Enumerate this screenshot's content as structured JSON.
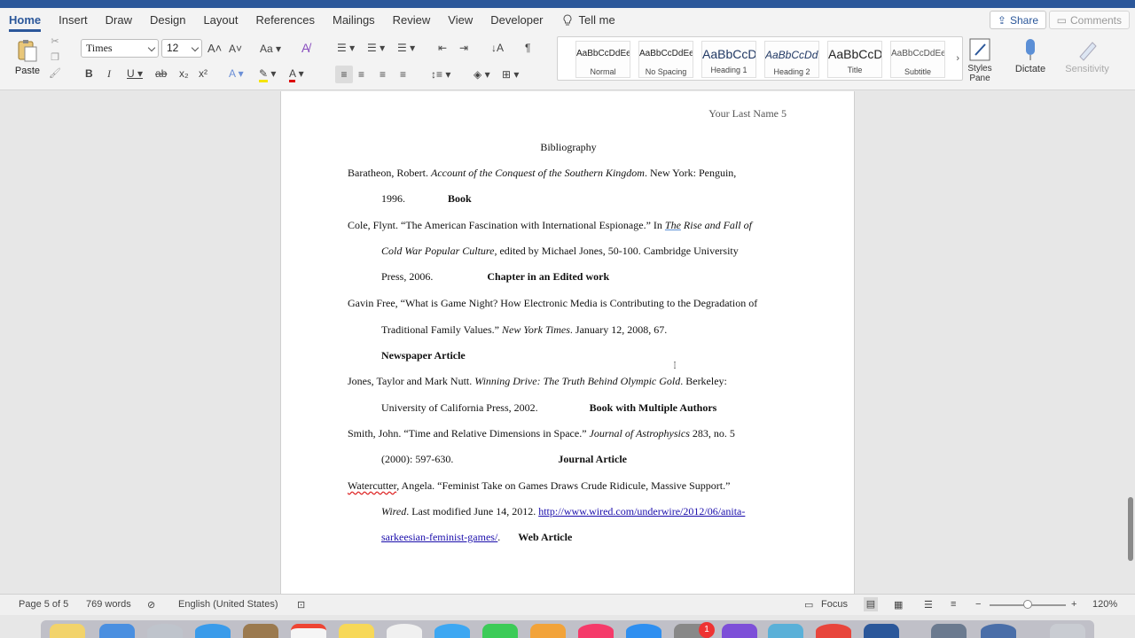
{
  "ribbon_tabs": [
    "Home",
    "Insert",
    "Draw",
    "Design",
    "Layout",
    "References",
    "Mailings",
    "Review",
    "View",
    "Developer"
  ],
  "tell_me": "Tell me",
  "share": "Share",
  "comments": "Comments",
  "clipboard": {
    "paste": "Paste"
  },
  "font": {
    "name": "Times",
    "size": "12"
  },
  "styles": [
    {
      "sample": "AaBbCcDdEe",
      "label": "Normal"
    },
    {
      "sample": "AaBbCcDdEe",
      "label": "No Spacing"
    },
    {
      "sample": "AaBbCcDc",
      "label": "Heading 1"
    },
    {
      "sample": "AaBbCcDdE",
      "label": "Heading 2"
    },
    {
      "sample": "AaBbCcDc",
      "label": "Title"
    },
    {
      "sample": "AaBbCcDdEe",
      "label": "Subtitle"
    }
  ],
  "styles_pane": "Styles\nPane",
  "dictate": "Dictate",
  "sensitivity": "Sensitivity",
  "document": {
    "header": "Your Last Name 5",
    "title": "Bibliography",
    "e1_author": "Baratheon, Robert. ",
    "e1_title": "Account of the Conquest of the Southern Kingdom",
    "e1_rest": ". New York: Penguin,",
    "e1_year": "1996.",
    "e1_type": "Book",
    "e2_a": "Cole, Flynt. “The American Fascination with International Espionage.” In ",
    "e2_the": "The",
    "e2_b": " Rise and Fall of",
    "e2_c": "Cold War Popular Culture",
    "e2_d": ", edited by Michael Jones, 50-100. Cambridge University",
    "e2_e": "Press, 2006.",
    "e2_type": "Chapter in an Edited work",
    "e3_a": "Gavin Free, “What is Game Night? How Electronic Media is Contributing to the Degradation of",
    "e3_b": "Traditional Family Values.” ",
    "e3_c": "New York Times",
    "e3_d": ". January 12, 2008, 67.",
    "e3_type": "Newspaper Article",
    "e4_a": "Jones, Taylor and Mark Nutt. ",
    "e4_b": "Winning Drive: The Truth Behind Olympic Gold",
    "e4_c": ". Berkeley:",
    "e4_d": "University of California Press, 2002.",
    "e4_type": "Book with Multiple Authors",
    "e5_a": "Smith, John. “Time and Relative Dimensions in Space.” ",
    "e5_b": "Journal of Astrophysics",
    "e5_c": " 283, no. 5",
    "e5_d": "(2000): 597-630.",
    "e5_type": "Journal Article",
    "e6_a": "Watercutter",
    "e6_b": ", Angela. “Feminist Take on Games Draws Crude Ridicule, Massive Support.”",
    "e6_c": "Wired",
    "e6_d": ". Last modified June 14, 2012. ",
    "e6_link1": "http://www.wired.com/underwire/2012/06/anita-",
    "e6_link2": "sarkeesian-feminist-games/",
    "e6_e": ".",
    "e6_type": "Web Article"
  },
  "status": {
    "page": "Page 5 of 5",
    "words": "769 words",
    "language": "English (United States)",
    "focus": "Focus",
    "zoom": "120%",
    "zoom_level": 0.5
  },
  "dock_badge": "1"
}
